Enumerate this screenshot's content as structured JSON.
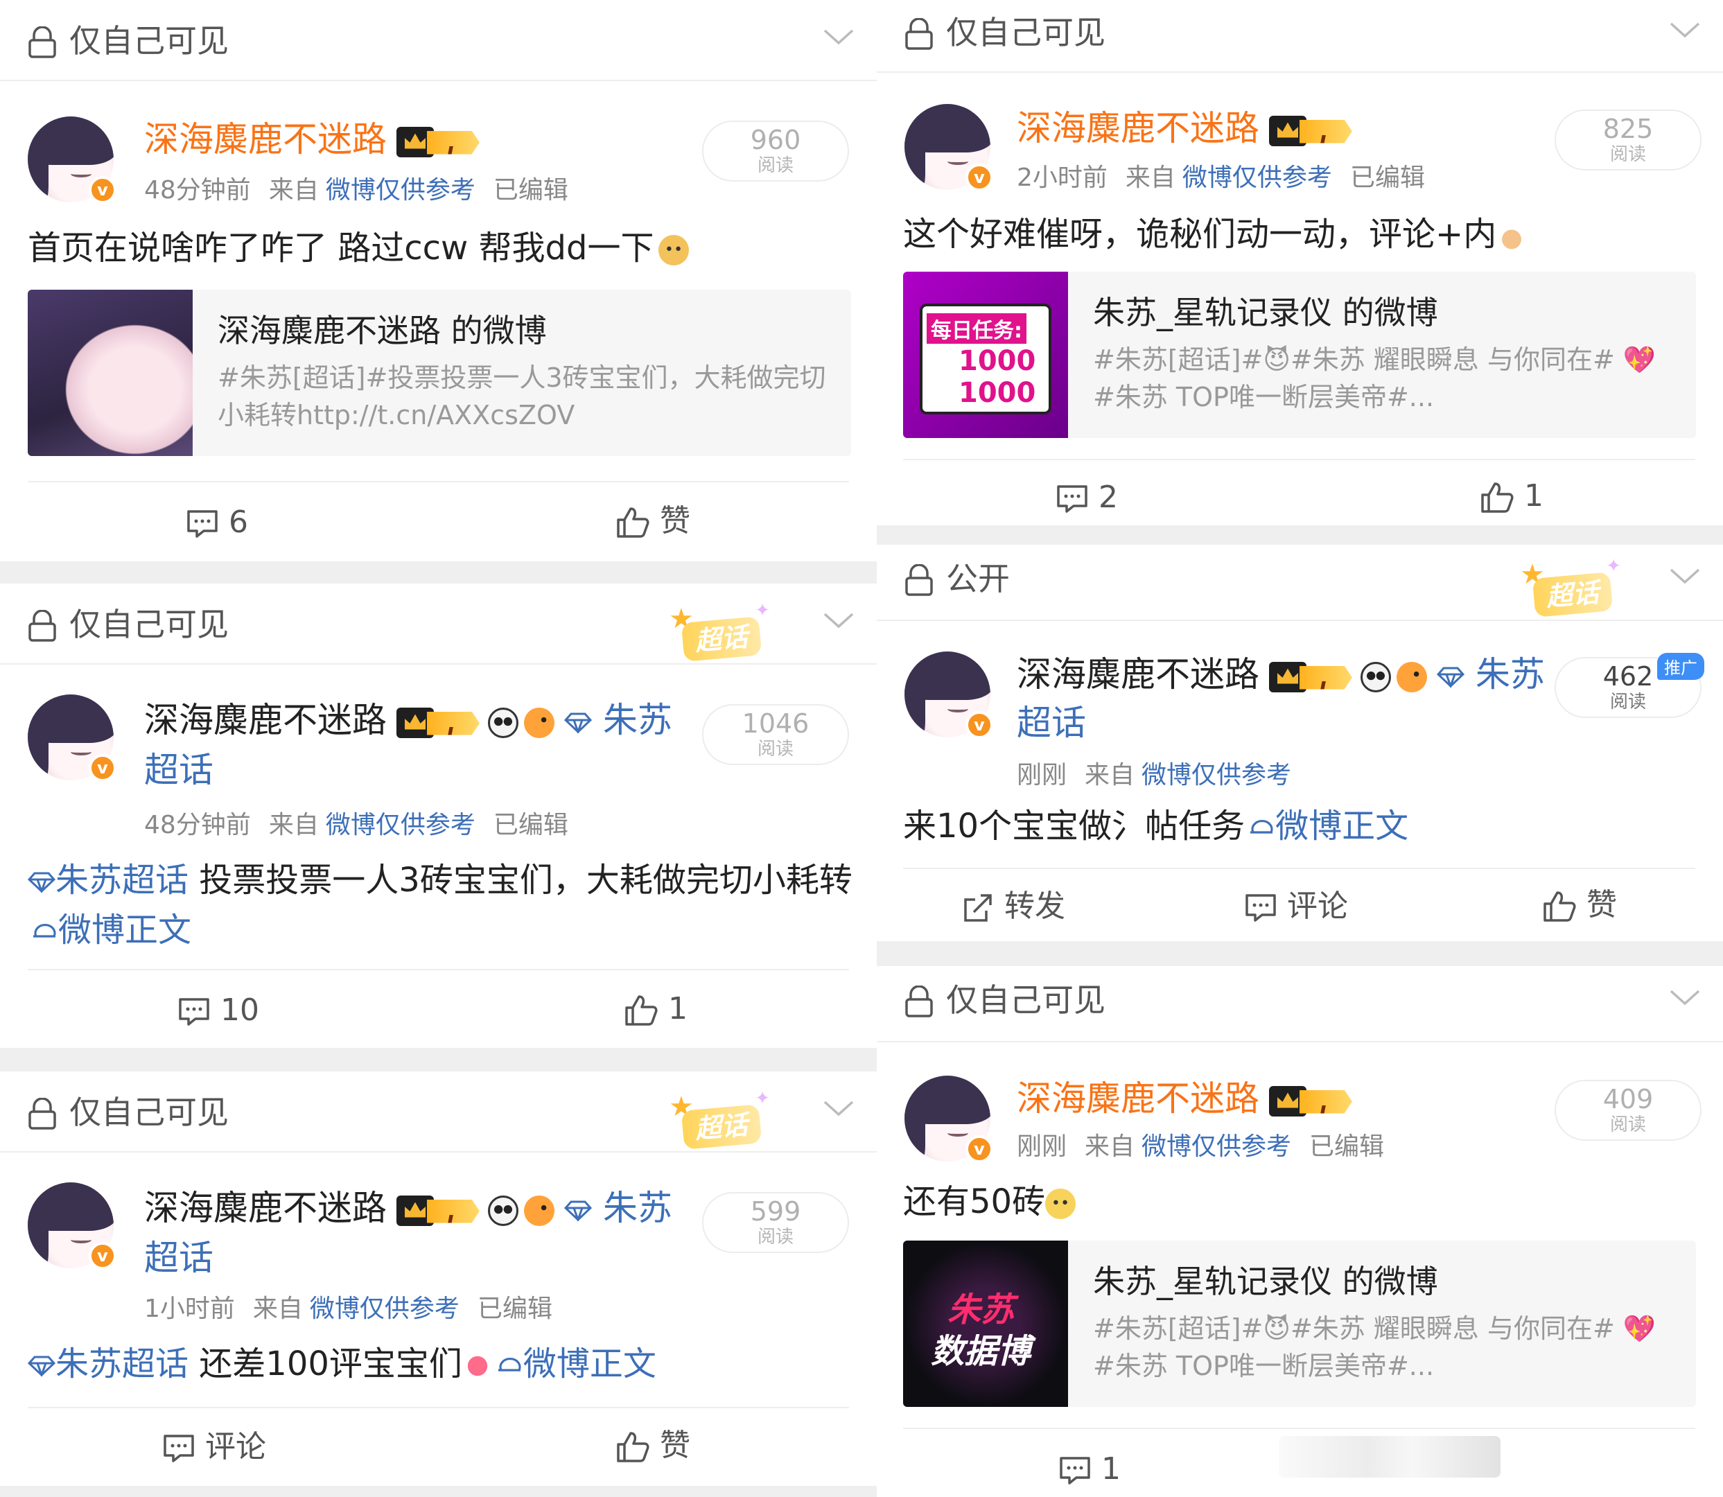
{
  "posts": [
    {
      "visibility": "仅自己可见",
      "author": "深海麋鹿不迷路",
      "time": "48分钟前",
      "from": "来自",
      "source": "微博仅供参考",
      "edited": "已编辑",
      "reads": "960",
      "reads_label": "阅读",
      "text": "首页在说啥咋了咋了 路过ccw 帮我dd一下",
      "quote": {
        "title": "深海麋鹿不迷路 的微博",
        "desc": "#朱苏[超话]#投票投票一人3砖宝宝们，大耗做完切小耗转http://t.cn/AXXcsZOV"
      },
      "comments": "6",
      "like_label": "赞"
    },
    {
      "visibility": "仅自己可见",
      "chaohua_badge": "超话",
      "author": "深海麋鹿不迷路",
      "topic_link": "朱苏",
      "topic_link2": "超话",
      "time": "48分钟前",
      "from": "来自",
      "source": "微博仅供参考",
      "edited": "已编辑",
      "reads": "1046",
      "reads_label": "阅读",
      "topic": "朱苏超话",
      "text": " 投票投票一人3砖宝宝们，大耗做完切小耗转",
      "weibo_text": "微博正文",
      "comments": "10",
      "likes": "1"
    },
    {
      "visibility": "仅自己可见",
      "chaohua_badge": "超话",
      "author": "深海麋鹿不迷路",
      "topic_link": "朱苏",
      "topic_link2": "超话",
      "time": "1小时前",
      "from": "来自",
      "source": "微博仅供参考",
      "edited": "已编辑",
      "reads": "599",
      "reads_label": "阅读",
      "topic": "朱苏超话",
      "text": " 还差100评宝宝们",
      "weibo_text": "微博正文",
      "comment_label": "评论",
      "like_label": "赞"
    },
    {
      "visibility": "仅自己可见",
      "author": "深海麋鹿不迷路",
      "time": "2小时前",
      "from": "来自",
      "source": "微博仅供参考",
      "edited": "已编辑",
      "reads": "825",
      "reads_label": "阅读",
      "text": "这个好难催呀，诡秘们动一动，评论+内",
      "quote": {
        "title": "朱苏_星轨记录仪 的微博",
        "desc": "#朱苏[超话]#😈#朱苏 耀眼瞬息 与你同在# 💖#朱苏 TOP唯一断层美帝#...",
        "img_line1": "每日任务:",
        "img_line2": "1000",
        "img_line3": "1000"
      },
      "comments": "2",
      "likes": "1"
    },
    {
      "visibility": "公开",
      "chaohua_badge": "超话",
      "author": "深海麋鹿不迷路",
      "topic_link": "朱苏",
      "topic_link2": "超话",
      "time": "刚刚",
      "from": "来自",
      "source": "微博仅供参考",
      "reads": "462",
      "reads_label": "阅读",
      "promo": "推广",
      "text": "来10个宝宝做氵帖任务",
      "weibo_text": "微博正文",
      "repost_label": "转发",
      "comment_label": "评论",
      "like_label": "赞"
    },
    {
      "visibility": "仅自己可见",
      "author": "深海麋鹿不迷路",
      "time": "刚刚",
      "from": "来自",
      "source": "微博仅供参考",
      "edited": "已编辑",
      "reads": "409",
      "reads_label": "阅读",
      "text": "还有50砖",
      "quote": {
        "title": "朱苏_星轨记录仪 的微博",
        "desc": "#朱苏[超话]#😈#朱苏 耀眼瞬息 与你同在# 💖#朱苏 TOP唯一断层美帝#...",
        "img_line1": "朱苏",
        "img_line2": "数据博"
      },
      "comments": "1"
    }
  ],
  "colors": {
    "accent_blue": "#3d6fb8",
    "vip_orange": "#f97316",
    "promo_blue": "#3d8ef7"
  }
}
